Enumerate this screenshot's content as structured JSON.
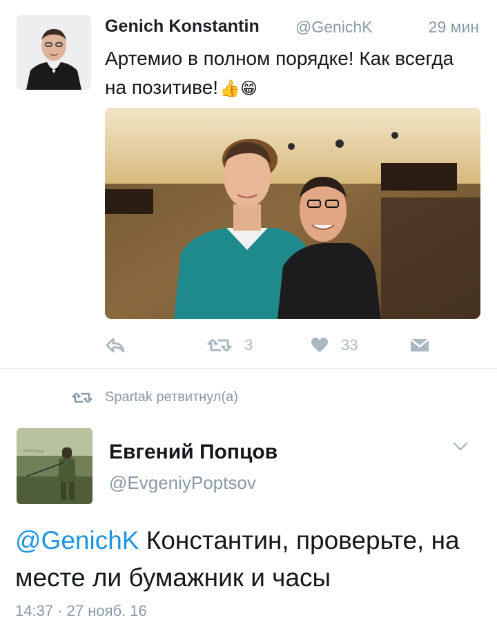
{
  "tweet1": {
    "name": "Genich Konstantin",
    "handle": "@GenichK",
    "time": "29 мин",
    "text": "Артемио в полном порядке! Как всегда на позитиве!",
    "emoji": "👍😁",
    "actions": {
      "reply_icon": "reply-icon",
      "retweet_icon": "retweet-icon",
      "retweet_count": "3",
      "like_icon": "heart-icon",
      "like_count": "33",
      "dm_icon": "envelope-icon"
    }
  },
  "retweet_context": {
    "label": "Spartak ретвитнул(а)",
    "icon": "retweet-icon"
  },
  "tweet2": {
    "name": "Евгений Попцов",
    "handle": "@EvgeniyPoptsov",
    "mention": "@GenichK",
    "text": " Константин, проверьте, на месте ли бумажник и часы",
    "timestamp": "14:37 · 27 нояб. 16",
    "menu_icon": "chevron-down-icon"
  },
  "colors": {
    "link": "#1b95e0",
    "muted": "#8899a6",
    "action": "#aab8c2",
    "divider": "#e1e8ed"
  }
}
